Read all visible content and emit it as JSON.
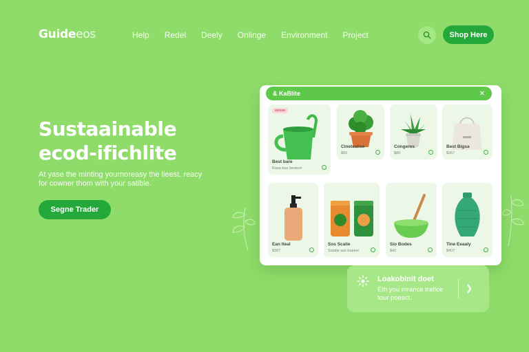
{
  "header": {
    "logo_main": "Guide",
    "logo_sub": "eos",
    "nav": [
      "Help",
      "Redel",
      "Deely",
      "Onlinge",
      "Environment",
      "Project"
    ],
    "shop_label": "Shop Here"
  },
  "hero": {
    "title_line1": "Sustaainable",
    "title_line2": "ecod-ifichlite",
    "desc_line1": "At yase the minting yournoreasy the lieest, reacy",
    "desc_line2": "for cowner thom with your satible.",
    "button_label": "Segne Trader"
  },
  "panel": {
    "title": "& KaBlite",
    "close_icon": "close-icon",
    "products": [
      {
        "name": "Best bare",
        "price": "Rasa bae bestore",
        "badge": "eeisse",
        "icon": "green-mug-icon"
      },
      {
        "name": "Cinetealise",
        "price": "$80",
        "icon": "potted-plant-icon"
      },
      {
        "name": "Congeres",
        "price": "$80",
        "icon": "succulent-icon"
      },
      {
        "name": "Best Bigsa",
        "price": "$367",
        "icon": "tote-bag-icon"
      },
      {
        "name": "Ean Iteal",
        "price": "$387",
        "icon": "soap-bottle-icon"
      },
      {
        "name": "Sos Scalie",
        "price": "Salatie sas boaker",
        "icon": "jars-icon"
      },
      {
        "name": "Sio Bodes",
        "price": "$40",
        "icon": "bowl-spoon-icon"
      },
      {
        "name": "Tine Eeaaly",
        "price": "$407",
        "icon": "vase-icon"
      }
    ]
  },
  "promo": {
    "title": "Loakobinit doet",
    "desc_line1": "Eth you mrance trafice",
    "desc_line2": "tour poesct.",
    "icon": "leaf-sparkle-icon",
    "arrow_icon": "chevron-right-icon"
  },
  "colors": {
    "background": "#8fdc6a",
    "accent": "#25a83a",
    "panel_header": "#5ec84a"
  }
}
